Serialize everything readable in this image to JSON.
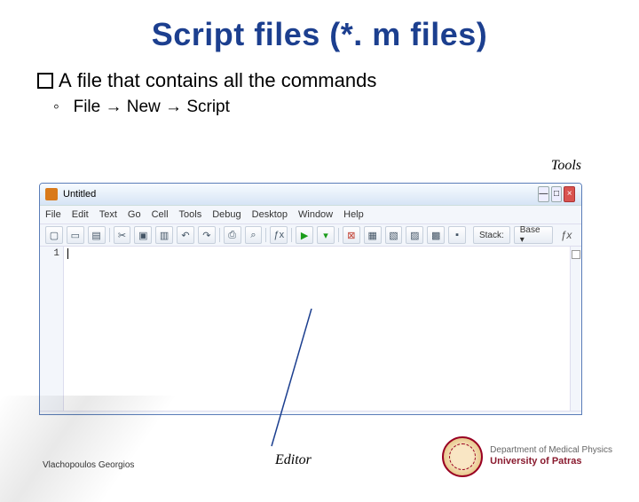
{
  "title": "Script files (*. m files)",
  "bullet": {
    "prefix": "A",
    "text": "file that contains all the commands"
  },
  "sub": {
    "marker": "◦",
    "path": "File → New → Script"
  },
  "labels": {
    "tools": "Tools",
    "editor": "Editor"
  },
  "author": "Vlachopoulos Georgios",
  "logo": {
    "line1": "Department of Medical Physics",
    "line2": "University of Patras"
  },
  "matlab": {
    "window_title": "Untitled",
    "menu": [
      "File",
      "Edit",
      "Text",
      "Go",
      "Cell",
      "Tools",
      "Debug",
      "Desktop",
      "Window",
      "Help"
    ],
    "win_btns": {
      "min": "—",
      "max": "□",
      "close": "×"
    },
    "toolbar": {
      "new": "▢",
      "open": "▭",
      "save": "▤",
      "cut": "✂",
      "copy": "▣",
      "paste": "▥",
      "undo": "↶",
      "redo": "↷",
      "print": "⎙",
      "find": "⌕",
      "fx": "ƒx",
      "run": "▶",
      "run_dd": "▾",
      "bp": "⊠",
      "g1": "▦",
      "g2": "▧",
      "g3": "▨",
      "g4": "▩",
      "g5": "▪",
      "stack_label": "Stack:",
      "stack_value": "Base ▾",
      "fx2": "ƒx"
    },
    "gutter": "1"
  }
}
